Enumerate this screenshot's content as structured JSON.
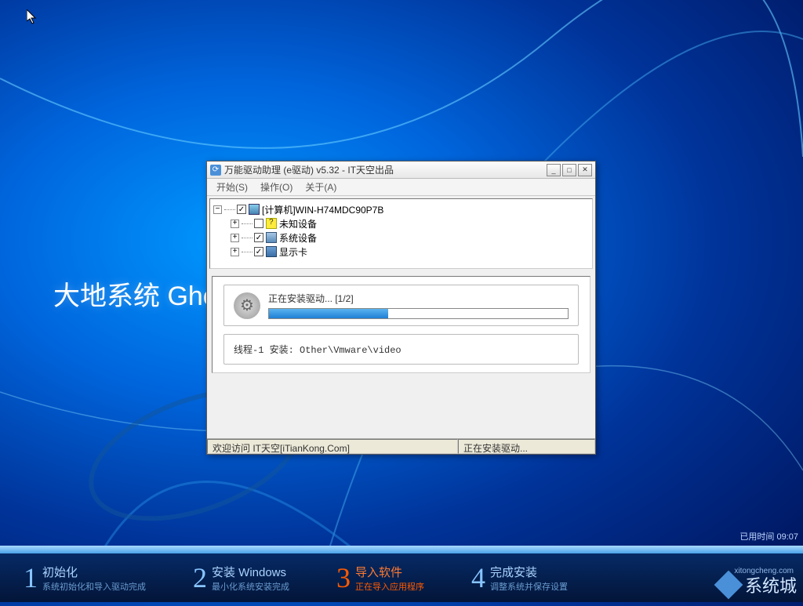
{
  "desktop": {
    "title_left": "大地系统 Gho"
  },
  "window": {
    "title": "万能驱动助理 (e驱动) v5.32 - IT天空出品",
    "menus": {
      "start": "开始(S)",
      "action": "操作(O)",
      "about": "关于(A)"
    },
    "tree": {
      "root": "[计算机]WIN-H74MDC90P7B",
      "items": [
        {
          "label": "未知设备",
          "checked": false,
          "icon": "unknown"
        },
        {
          "label": "系统设备",
          "checked": true,
          "icon": "system"
        },
        {
          "label": "显示卡",
          "checked": true,
          "icon": "display"
        }
      ]
    },
    "progress": {
      "label": "正在安装驱动... [1/2]",
      "thread": "线程-1 安装:  Other\\Vmware\\video"
    },
    "status": {
      "left": "欢迎访问 IT天空[iTianKong.Com]",
      "right": "正在安装驱动..."
    }
  },
  "elapsed": "已用时间 09:07",
  "steps": [
    {
      "num": "1",
      "title": "初始化",
      "sub": "系统初始化和导入驱动完成",
      "active": false
    },
    {
      "num": "2",
      "title": "安装 Windows",
      "sub": "最小化系统安装完成",
      "active": false
    },
    {
      "num": "3",
      "title": "导入软件",
      "sub": "正在导入应用程序",
      "active": true
    },
    {
      "num": "4",
      "title": "完成安装",
      "sub": "调整系统并保存设置",
      "active": false
    }
  ],
  "watermark": {
    "site": "xitongcheng.com",
    "brand": "系统城"
  }
}
